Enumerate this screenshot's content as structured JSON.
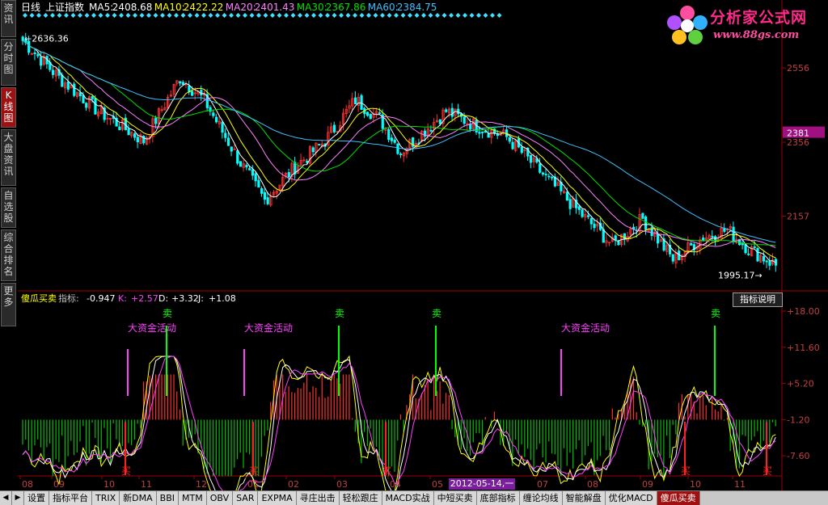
{
  "sidebar": {
    "items": [
      {
        "label": "资讯",
        "active": false
      },
      {
        "label": "分时图",
        "active": false
      },
      {
        "label": "K线图",
        "active": true
      },
      {
        "label": "大盘资讯",
        "active": false
      },
      {
        "label": "自选股",
        "active": false
      },
      {
        "label": "综合排名",
        "active": false
      },
      {
        "label": "更多",
        "active": false
      }
    ]
  },
  "header": {
    "period": "日线",
    "index_name": "上证指数",
    "ma": [
      {
        "label": "MA5:",
        "value": "2408.68",
        "color": "#ffffff"
      },
      {
        "label": "MA10:",
        "value": "2422.22",
        "color": "#ffff00"
      },
      {
        "label": "MA20:",
        "value": "2401.43",
        "color": "#ff80ff"
      },
      {
        "label": "MA30:",
        "value": "2367.86",
        "color": "#00e000"
      },
      {
        "label": "MA60:",
        "value": "2384.75",
        "color": "#40c0ff"
      }
    ]
  },
  "logo": {
    "brand": "分析家公式网",
    "url": "www.88gs.com"
  },
  "price_axis": {
    "labels": [
      "2556",
      "2356",
      "2157"
    ],
    "current": "2381",
    "high_mark": "2636.36",
    "low_mark": "1995.17"
  },
  "indicator": {
    "name": "傻瓜买卖",
    "label_zhibiao": "指标:",
    "zhibiao_value": "-0.947",
    "k_label": "K:",
    "k_value": "+2.57",
    "d_label": "D:",
    "d_value": "+3.32",
    "j_label": "J:",
    "j_value": "+1.08",
    "axis": [
      "+18.00",
      "+11.60",
      "+5.20",
      "-1.20",
      "-7.60"
    ],
    "explain_button": "指标说明",
    "annotation_big": "大资金活动",
    "sell_label": "卖",
    "buy_label": "买"
  },
  "time_axis": {
    "labels": [
      "08",
      "09",
      "10",
      "11",
      "12",
      "01",
      "02",
      "03",
      "04",
      "05",
      "07",
      "08",
      "09",
      "10",
      "11"
    ],
    "cursor_date": "2012-05-14,一"
  },
  "bottom_tabs": [
    "设置",
    "指标平台",
    "TRIX",
    "新DMA",
    "BBI",
    "MTM",
    "OBV",
    "SAR",
    "EXPMA",
    "寻庄出击",
    "轻松跟庄",
    "MACD实战",
    "中短买卖",
    "底部指标",
    "缠论均线",
    "智能解盘",
    "优化MACD",
    "傻瓜买卖"
  ],
  "bottom_active": "傻瓜买卖",
  "colors": {
    "up": "#ff3030",
    "down": "#00ffff",
    "ma5": "#ffffff",
    "ma10": "#ffff00",
    "ma20": "#ff80ff",
    "ma30": "#00e000",
    "ma60": "#40c0ff",
    "axis": "#a00000"
  }
}
